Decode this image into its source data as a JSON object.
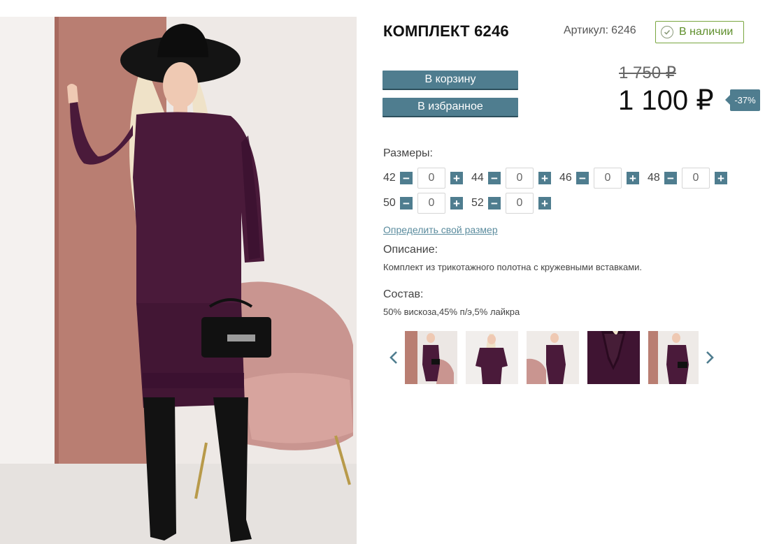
{
  "product": {
    "title": "КОМПЛЕКТ 6246",
    "article_label": "Артикул:",
    "article_value": "6246",
    "stock_status": "В наличии"
  },
  "actions": {
    "cart_label": "В корзину",
    "favorite_label": "В избранное"
  },
  "price": {
    "old": "1 750 ₽",
    "current": "1 100 ₽",
    "discount": "-37%"
  },
  "sizes": {
    "label": "Размеры:",
    "items": [
      {
        "size": "42",
        "qty": "0"
      },
      {
        "size": "44",
        "qty": "0"
      },
      {
        "size": "46",
        "qty": "0"
      },
      {
        "size": "48",
        "qty": "0"
      },
      {
        "size": "50",
        "qty": "0"
      },
      {
        "size": "52",
        "qty": "0"
      }
    ]
  },
  "size_link": "Определить свой размер",
  "description": {
    "label": "Описание:",
    "text": "Комплект из трикотажного полотна с кружевными вставками."
  },
  "composition": {
    "label": "Состав:",
    "text": "50% вискоза,45% п/э,5% лайкра"
  },
  "colors": {
    "accent": "#4f7d8f",
    "stock_green": "#79a63f",
    "dress_purple": "#4a1a3a",
    "wall_pink": "#b97e72"
  },
  "icons": {
    "stock": "check-circle-icon",
    "minus": "minus-icon",
    "plus": "plus-icon",
    "prev": "chevron-left-icon",
    "next": "chevron-right-icon"
  }
}
